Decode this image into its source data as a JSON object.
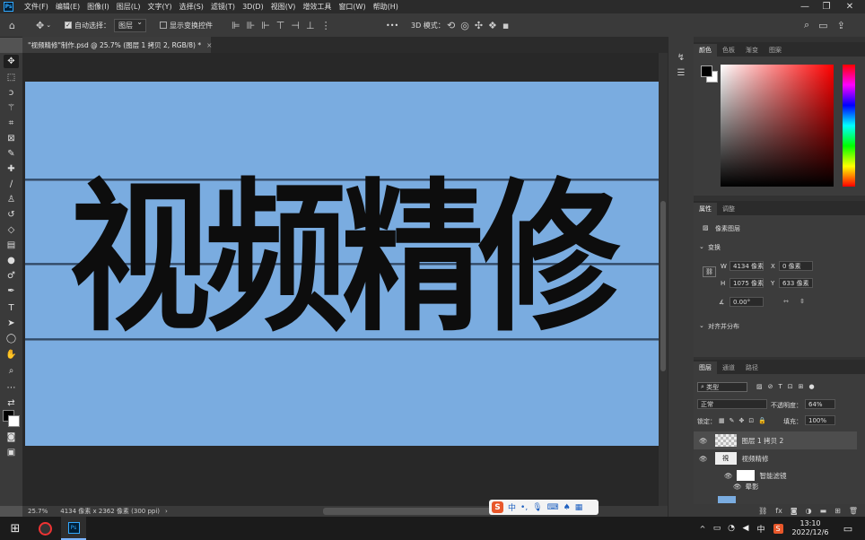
{
  "app": {
    "logo": "Ps",
    "menu": [
      "文件(F)",
      "编辑(E)",
      "图像(I)",
      "图层(L)",
      "文字(Y)",
      "选择(S)",
      "滤镜(T)",
      "3D(D)",
      "视图(V)",
      "增效工具",
      "窗口(W)",
      "帮助(H)"
    ],
    "window_controls": [
      "—",
      "❐",
      "✕"
    ]
  },
  "options_bar": {
    "auto_select_label": "自动选择：",
    "auto_select_value": "图层",
    "show_transform_label": "显示变换控件",
    "mode_3d_label": "3D 模式：",
    "more": "•••"
  },
  "document": {
    "tab_title": "\"视频精修\"制作.psd @ 25.7% (图层 1 拷贝 2, RGB/8) *",
    "tab_close": "×",
    "canvas_text": "视频精修",
    "canvas_bg_color": "#7aace0"
  },
  "status": {
    "zoom": "25.7%",
    "doc_info": "4134 像素 x 2362 像素 (300 ppi)",
    "arrow": "›"
  },
  "color_panel": {
    "tabs": [
      "颜色",
      "色板",
      "渐变",
      "图案"
    ],
    "foreground": "#000000",
    "background": "#ffffff",
    "hue_base": "#ff0000"
  },
  "properties_panel": {
    "tabs": [
      "属性",
      "调整"
    ],
    "type_label": "像素图层",
    "transform_label": "变换",
    "w_label": "W",
    "w_value": "4134 像素",
    "x_label": "X",
    "x_value": "0 像素",
    "h_label": "H",
    "h_value": "1075 像素",
    "y_label": "Y",
    "y_value": "633 像素",
    "angle_value": "0.00°",
    "align_label": "对齐并分布"
  },
  "layers_panel": {
    "tabs": [
      "图层",
      "通道",
      "路径"
    ],
    "filter_value": "类型",
    "blend_mode": "正常",
    "opacity_label": "不透明度：",
    "opacity_value": "64%",
    "lock_label": "锁定：",
    "fill_label": "填充：",
    "fill_value": "100%",
    "layers": [
      {
        "name": "图层 1 拷贝 2",
        "selected": true
      },
      {
        "name": "视频精修",
        "selected": false
      },
      {
        "name": "智能滤镜",
        "selected": false
      },
      {
        "name": "晕影",
        "selected": false
      }
    ],
    "bottom_icons": [
      "fx"
    ]
  },
  "ime": {
    "logo": "S",
    "mode": "中",
    "dot": "•,"
  },
  "taskbar": {
    "tray_lang": "中",
    "time": "13:10",
    "date": "2022/12/6",
    "ps_label": "Ps"
  }
}
